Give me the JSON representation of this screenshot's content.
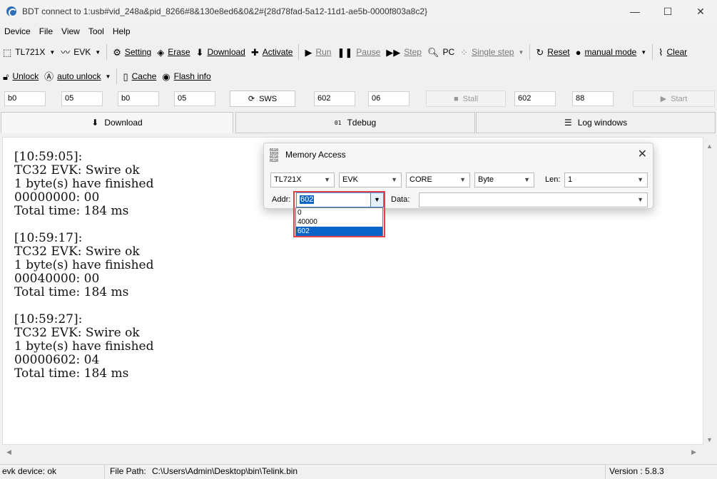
{
  "window": {
    "title": "BDT connect to 1:usb#vid_248a&pid_8266#8&130e8ed6&0&2#{28d78fad-5a12-11d1-ae5b-0000f803a8c2}",
    "minimize": "—",
    "maximize": "☐",
    "close": "✕"
  },
  "menu": [
    "Device",
    "File",
    "View",
    "Tool",
    "Help"
  ],
  "toolbar1": {
    "chip": "TL721X",
    "board": "EVK",
    "setting": "Setting",
    "erase": "Erase",
    "download": "Download",
    "activate": "Activate",
    "run": "Run",
    "pause": "Pause",
    "step": "Step",
    "pc": "PC",
    "single_step": "Single step",
    "reset": "Reset",
    "mode": "manual mode",
    "clear": "Clear"
  },
  "toolbar2": {
    "unlock": "Unlock",
    "auto_unlock": "auto unlock",
    "cache": "Cache",
    "flash_info": "Flash info"
  },
  "fields": {
    "f1": "b0",
    "f2": "05",
    "f3": "b0",
    "f4": "05",
    "sws": "SWS",
    "f5": "602",
    "f6": "06",
    "stall": "Stall",
    "f7": "602",
    "f8": "88",
    "start": "Start"
  },
  "tabs": {
    "download": "Download",
    "tdebug": "Tdebug",
    "log": "Log windows"
  },
  "log": "[10:59:05]:\nTC32 EVK: Swire ok\n1 byte(s) have finished\n00000000: 00\nTotal time: 184 ms\n\n[10:59:17]:\nTC32 EVK: Swire ok\n1 byte(s) have finished\n00040000: 00\nTotal time: 184 ms\n\n[10:59:27]:\nTC32 EVK: Swire ok\n1 byte(s) have finished\n00000602: 04\nTotal time: 184 ms",
  "status": {
    "device": "evk device: ok",
    "file_path_label": "File Path:",
    "file_path": "C:\\Users\\Admin\\Desktop\\bin\\Telink.bin",
    "version": "Version : 5.8.3"
  },
  "dialog": {
    "title": "Memory Access",
    "icon_text": "0110\n1010\n0110\n0110",
    "chip": "TL721X",
    "board": "EVK",
    "core": "CORE",
    "unit": "Byte",
    "len_label": "Len:",
    "len": "1",
    "addr_label": "Addr:",
    "addr": "602",
    "data_label": "Data:",
    "data": "",
    "addr_options": [
      "0",
      "40000",
      "602"
    ],
    "selected_option": "602"
  },
  "colors": {
    "accent": "#0a64c8",
    "highlight": "#e0424b"
  }
}
